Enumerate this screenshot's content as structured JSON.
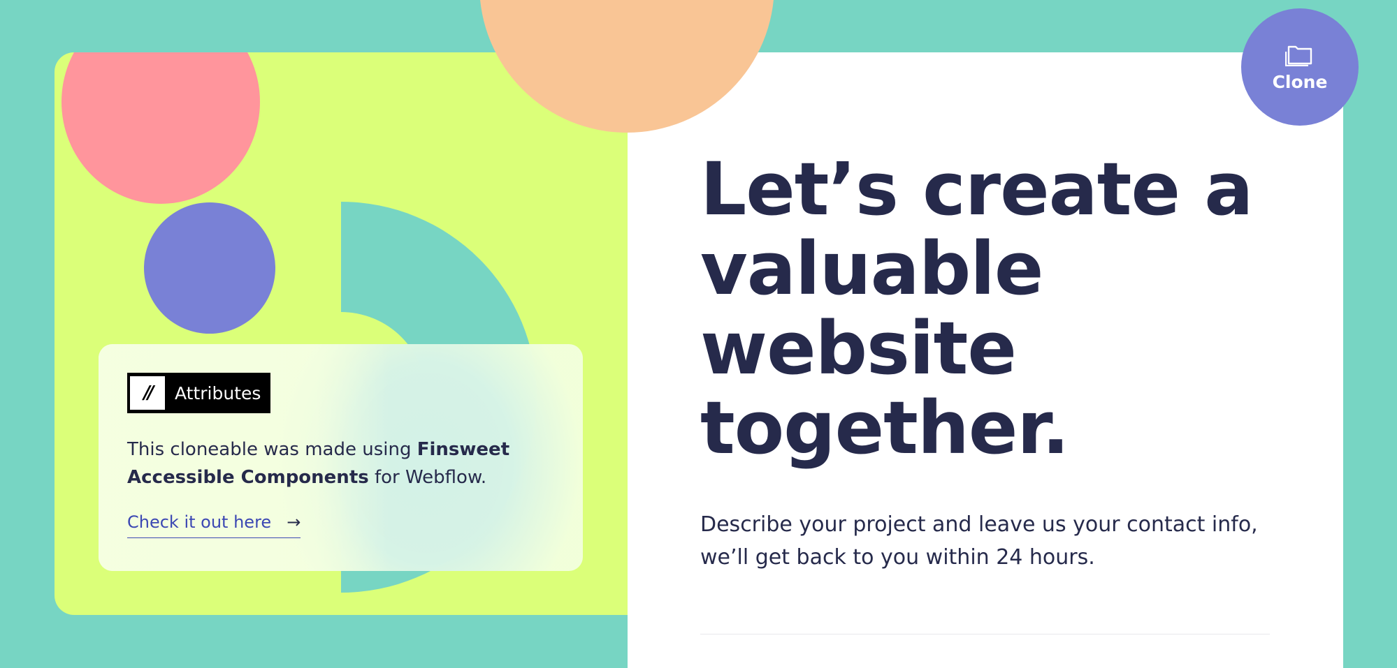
{
  "clone_button": {
    "label": "Clone",
    "icon": "folder-icon"
  },
  "hero": {
    "headline_lines": [
      "Let’s create a",
      "valuable",
      "website",
      "together."
    ],
    "description": "Describe your project and leave us your contact info, we’ll get back to you within 24 hours."
  },
  "attributes_card": {
    "logo_mark": "//",
    "logo_text": "Attributes",
    "text_before": "This cloneable was made using ",
    "text_bold": "Finsweet Accessible Components",
    "text_after": " for Webflow.",
    "link_label": "Check it out here",
    "link_arrow": "→"
  },
  "colors": {
    "background_teal": "#77d5c3",
    "lime": "#dbff79",
    "pink": "#ff959c",
    "peach": "#f9c595",
    "purple": "#7981d6",
    "navy_text": "#262a4b",
    "link_blue": "#3b47b3"
  }
}
